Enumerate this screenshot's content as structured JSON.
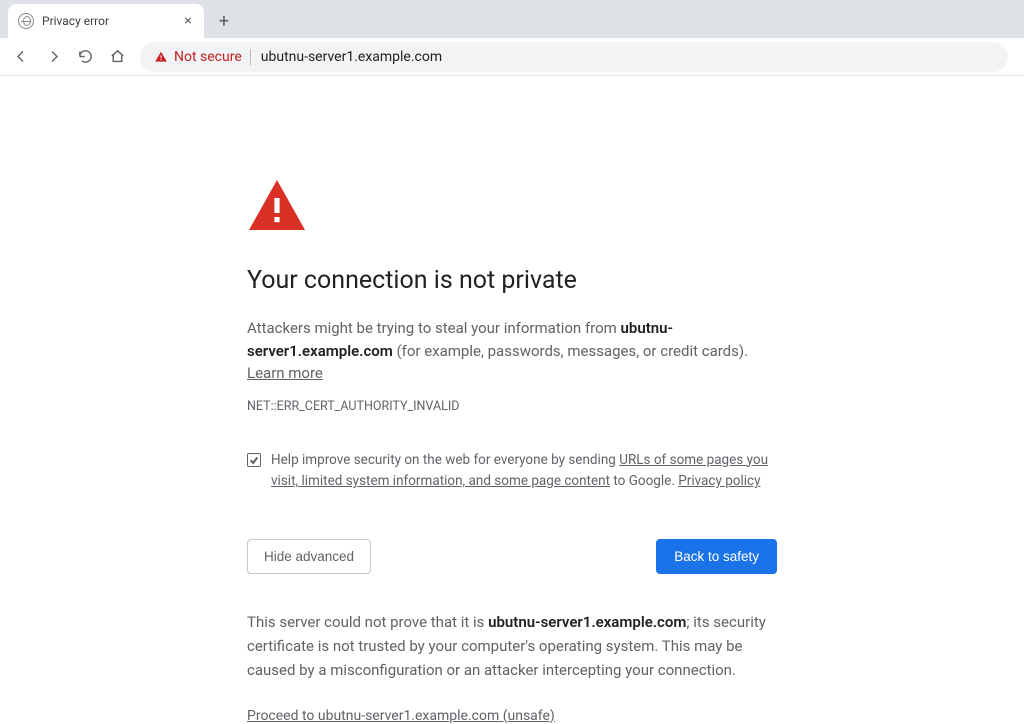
{
  "tab": {
    "title": "Privacy error"
  },
  "omnibox": {
    "not_secure_label": "Not secure",
    "url": "ubutnu-server1.example.com"
  },
  "interstitial": {
    "heading": "Your connection is not private",
    "body_prefix": "Attackers might be trying to steal your information from ",
    "body_host": "ubutnu-server1.example.com",
    "body_suffix": " (for example, passwords, messages, or credit cards). ",
    "learn_more": "Learn more",
    "error_code": "NET::ERR_CERT_AUTHORITY_INVALID",
    "optin_prefix": "Help improve security on the web for everyone by sending ",
    "optin_link1": "URLs of some pages you visit, limited system information, and some page content",
    "optin_mid": " to Google. ",
    "optin_link2": "Privacy policy",
    "hide_advanced": "Hide advanced",
    "back_to_safety": "Back to safety",
    "advanced_prefix": "This server could not prove that it is ",
    "advanced_host": "ubutnu-server1.example.com",
    "advanced_suffix": "; its security certificate is not trusted by your computer's operating system. This may be caused by a misconfiguration or an attacker intercepting your connection.",
    "proceed": "Proceed to ubutnu-server1.example.com (unsafe)"
  }
}
